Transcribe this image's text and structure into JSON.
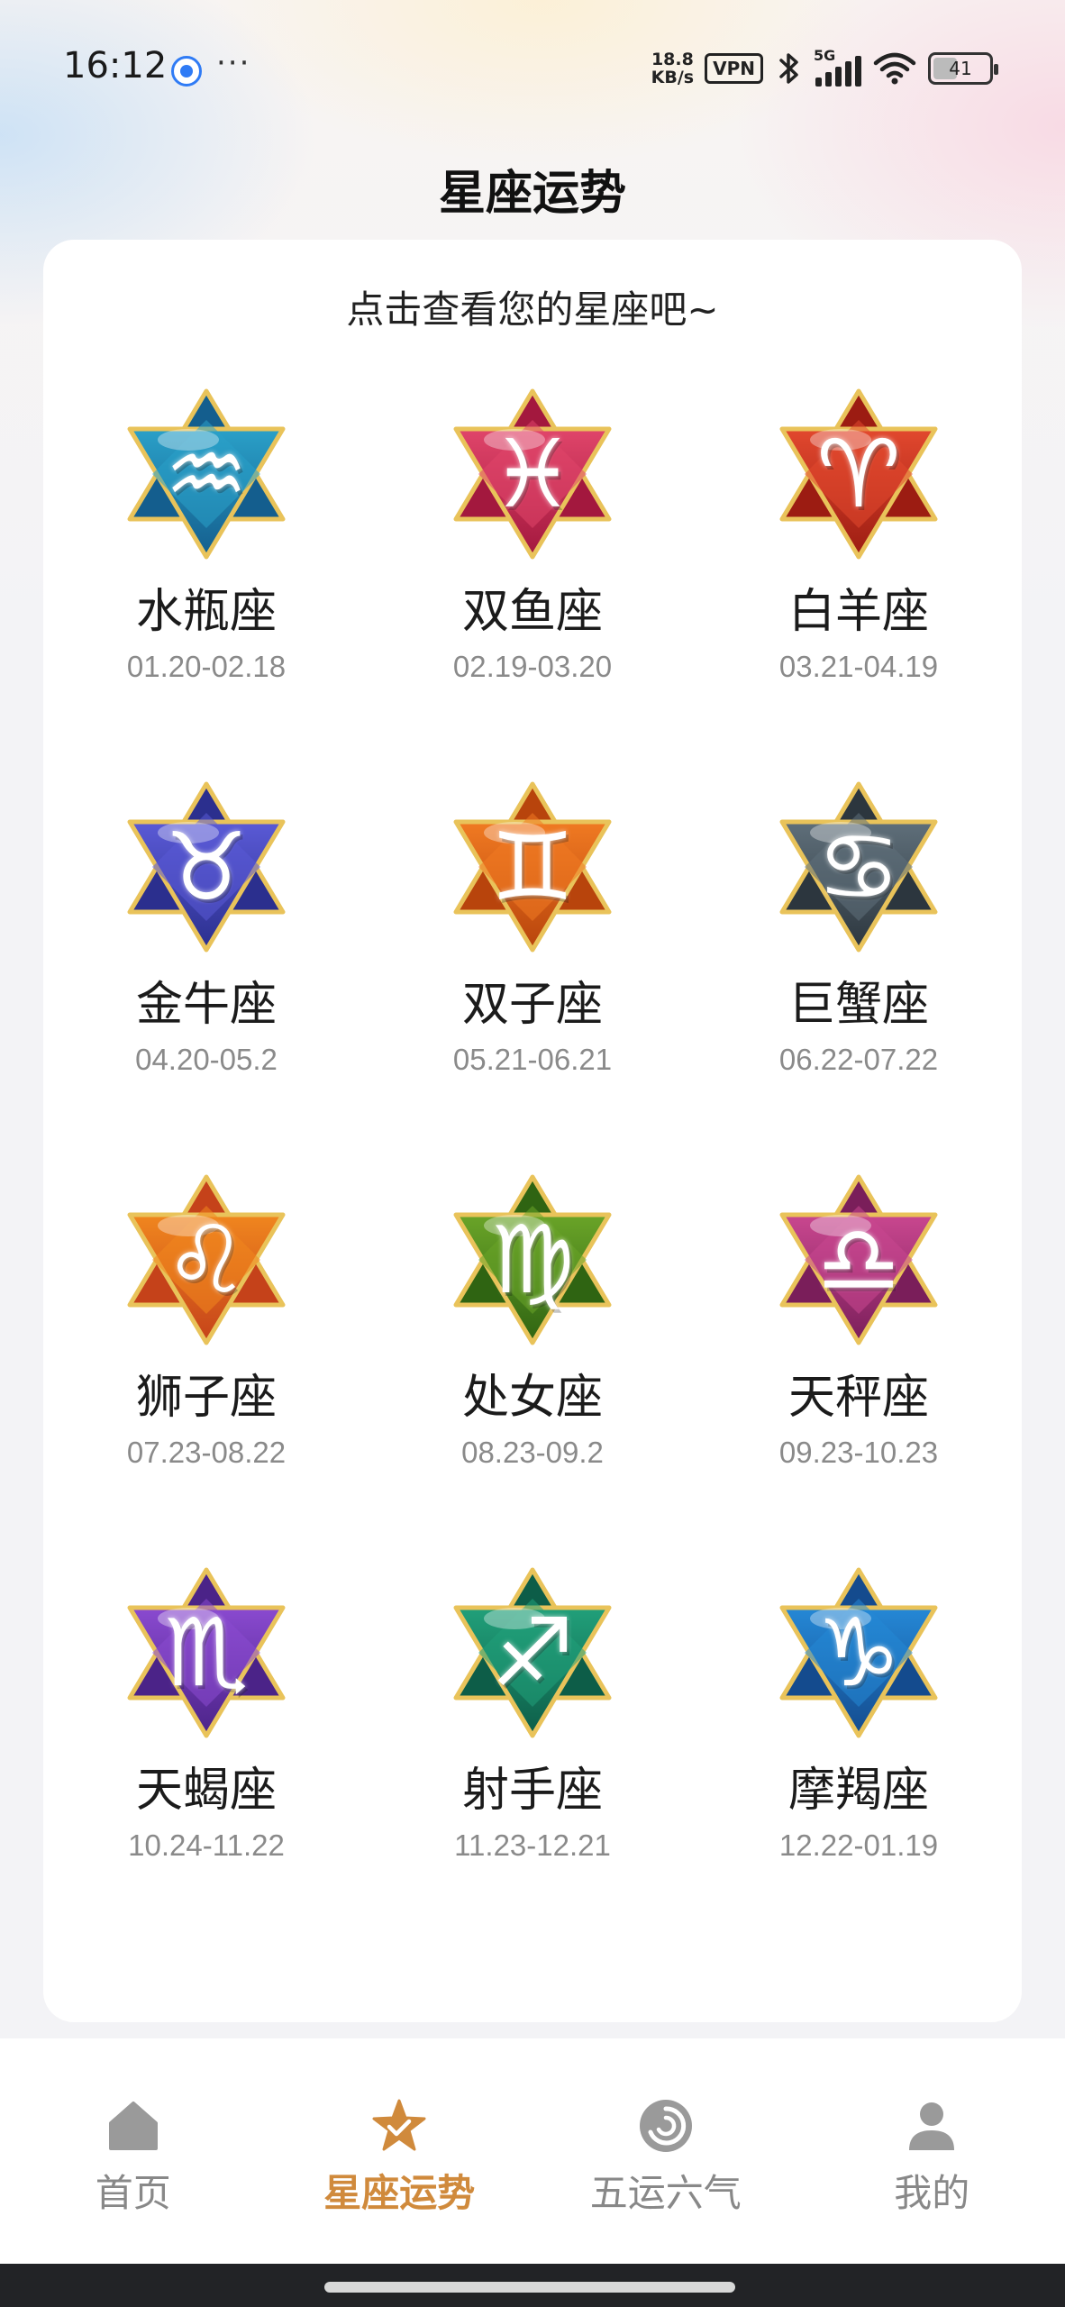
{
  "status_bar": {
    "time": "16:12",
    "more": "···",
    "net_speed_value": "18.8",
    "net_speed_unit": "KB/s",
    "vpn": "VPN",
    "network": "5G",
    "battery": "41"
  },
  "page": {
    "title": "星座运势",
    "subtitle": "点击查看您的星座吧~"
  },
  "zodiacs": [
    {
      "name": "水瓶座",
      "date": "01.20-02.18",
      "symbol": "♒",
      "color": "#2aa0c8",
      "color2": "#145e8e",
      "icon": "aquarius-icon"
    },
    {
      "name": "双鱼座",
      "date": "02.19-03.20",
      "symbol": "♓",
      "color": "#e0456a",
      "color2": "#a3183e",
      "icon": "pisces-icon"
    },
    {
      "name": "白羊座",
      "date": "03.21-04.19",
      "symbol": "♈",
      "color": "#e2482e",
      "color2": "#9c1c12",
      "icon": "aries-icon"
    },
    {
      "name": "金牛座",
      "date": "04.20-05.2",
      "symbol": "♉",
      "color": "#5a5ad6",
      "color2": "#2b2f8e",
      "icon": "taurus-icon"
    },
    {
      "name": "双子座",
      "date": "05.21-06.21",
      "symbol": "♊",
      "color": "#f07a22",
      "color2": "#b8440c",
      "icon": "gemini-icon"
    },
    {
      "name": "巨蟹座",
      "date": "06.22-07.22",
      "symbol": "♋",
      "color": "#5f6f7a",
      "color2": "#2c363e",
      "icon": "cancer-icon"
    },
    {
      "name": "狮子座",
      "date": "07.23-08.22",
      "symbol": "♌",
      "color": "#f0861e",
      "color2": "#c5421a",
      "icon": "leo-icon"
    },
    {
      "name": "处女座",
      "date": "08.23-09.2",
      "symbol": "♍",
      "color": "#6aa428",
      "color2": "#2f6412",
      "icon": "virgo-icon"
    },
    {
      "name": "天秤座",
      "date": "09.23-10.23",
      "symbol": "♎",
      "color": "#c9478f",
      "color2": "#7a1e5a",
      "icon": "libra-icon"
    },
    {
      "name": "天蝎座",
      "date": "10.24-11.22",
      "symbol": "♏",
      "color": "#8a4ad0",
      "color2": "#4b2388",
      "icon": "scorpio-icon"
    },
    {
      "name": "射手座",
      "date": "11.23-12.21",
      "symbol": "♐",
      "color": "#21a07a",
      "color2": "#0d5d48",
      "icon": "sagittarius-icon"
    },
    {
      "name": "摩羯座",
      "date": "12.22-01.19",
      "symbol": "♑",
      "color": "#2588d6",
      "color2": "#144b8e",
      "icon": "capricorn-icon"
    }
  ],
  "tabs": [
    {
      "label": "首页",
      "icon": "home-icon",
      "active": false
    },
    {
      "label": "星座运势",
      "icon": "star-icon",
      "active": true
    },
    {
      "label": "五运六气",
      "icon": "swirl-icon",
      "active": false
    },
    {
      "label": "我的",
      "icon": "user-icon",
      "active": false
    }
  ],
  "colors": {
    "accent": "#d08a3c",
    "inactive": "#9a9a9a"
  }
}
